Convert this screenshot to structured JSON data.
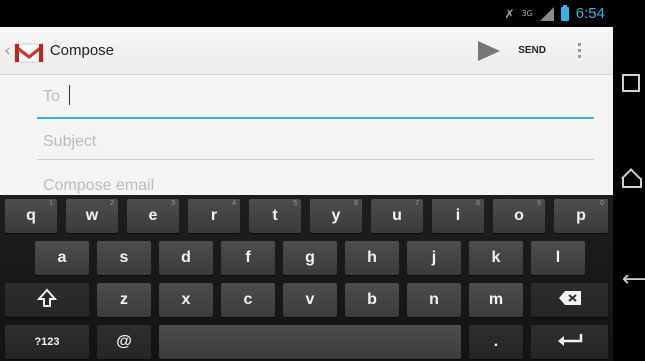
{
  "status_bar": {
    "time": "6:54",
    "network_label": "3G"
  },
  "action_bar": {
    "title": "Compose",
    "send_label": "SEND"
  },
  "compose": {
    "to_placeholder": "To",
    "subject_placeholder": "Subject",
    "body_placeholder": "Compose email"
  },
  "keyboard": {
    "row1": [
      {
        "label": "q",
        "hint": "1"
      },
      {
        "label": "w",
        "hint": "2"
      },
      {
        "label": "e",
        "hint": "3"
      },
      {
        "label": "r",
        "hint": "4"
      },
      {
        "label": "t",
        "hint": "5"
      },
      {
        "label": "y",
        "hint": "6"
      },
      {
        "label": "u",
        "hint": "7"
      },
      {
        "label": "i",
        "hint": "8"
      },
      {
        "label": "o",
        "hint": "9"
      },
      {
        "label": "p",
        "hint": "0"
      }
    ],
    "row2": [
      "a",
      "s",
      "d",
      "f",
      "g",
      "h",
      "j",
      "k",
      "l"
    ],
    "row3": [
      "z",
      "x",
      "c",
      "v",
      "b",
      "n",
      "m"
    ],
    "row4": {
      "symbols": "?123",
      "at": "@",
      "period": "."
    },
    "icons": {
      "shift": "shift-arrow-icon",
      "delete": "backspace-icon",
      "enter": "enter-return-icon"
    }
  },
  "nav_bar": {
    "icons": [
      "recent-apps-icon",
      "home-icon",
      "back-icon"
    ]
  },
  "colors": {
    "accent": "#33b5e5",
    "gmail_red": "#d93025"
  }
}
